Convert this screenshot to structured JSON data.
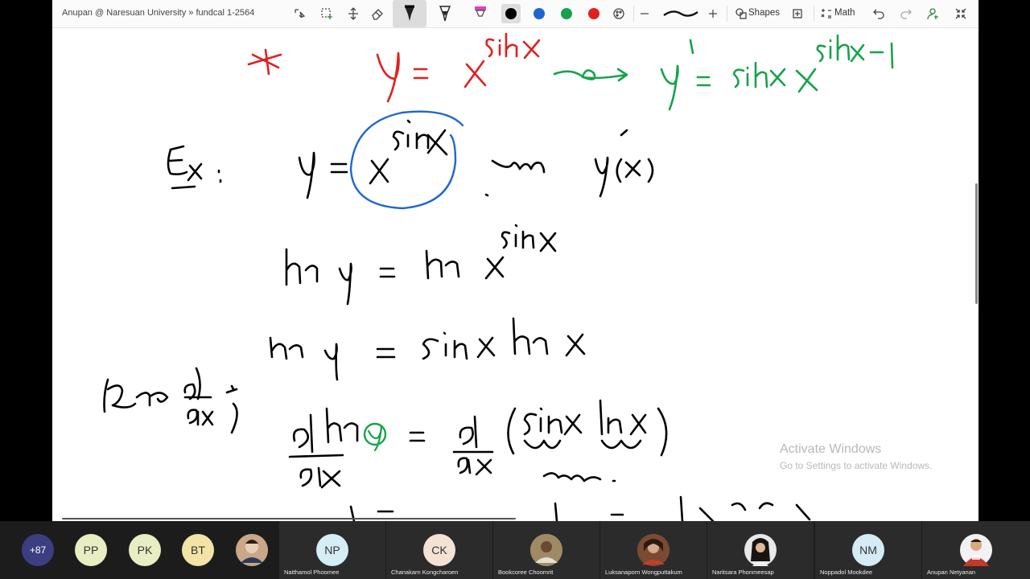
{
  "window": {
    "title": "Anupan @ Naresuan University » fundcal 1-2564"
  },
  "toolbar": {
    "shapes_label": "Shapes",
    "math_label": "Math",
    "colors": [
      "#000000",
      "#1e66d0",
      "#16a34a",
      "#e02020"
    ],
    "selected_color": "#000000",
    "ink_red": "#e02020",
    "ink_green": "#16a34a",
    "ink_blue": "#1e66d0",
    "ink_black": "#000000"
  },
  "watermark": {
    "line1": "Activate Windows",
    "line2": "Go to Settings to activate Windows."
  },
  "participants": {
    "more_count": "+87",
    "initials": [
      {
        "initials": "PP",
        "color": "#e8eec2"
      },
      {
        "initials": "PK",
        "color": "#e8eec2"
      },
      {
        "initials": "BT",
        "color": "#f3e3a6"
      }
    ],
    "tiles": [
      {
        "name": "Natthamol Phoomee",
        "initials": "NP",
        "color": "#d5edf5"
      },
      {
        "name": "Chanakarn Kongcharoen",
        "initials": "CK",
        "color": "#f5e2d4"
      },
      {
        "name": "Bookcoree Choomrit",
        "initials": "",
        "color": "#8b7a5e"
      },
      {
        "name": "Luksanaporn Wongputtakum",
        "initials": "",
        "color": "#9c6a4a"
      },
      {
        "name": "Naritsara Phonmeesap",
        "initials": "",
        "color": "#3a2a1e"
      },
      {
        "name": "Noppadol Mookdee",
        "initials": "NM",
        "color": "#d5ebf5"
      },
      {
        "name": "Anupan Netyanan",
        "initials": "",
        "color": "#c0392b"
      }
    ]
  }
}
